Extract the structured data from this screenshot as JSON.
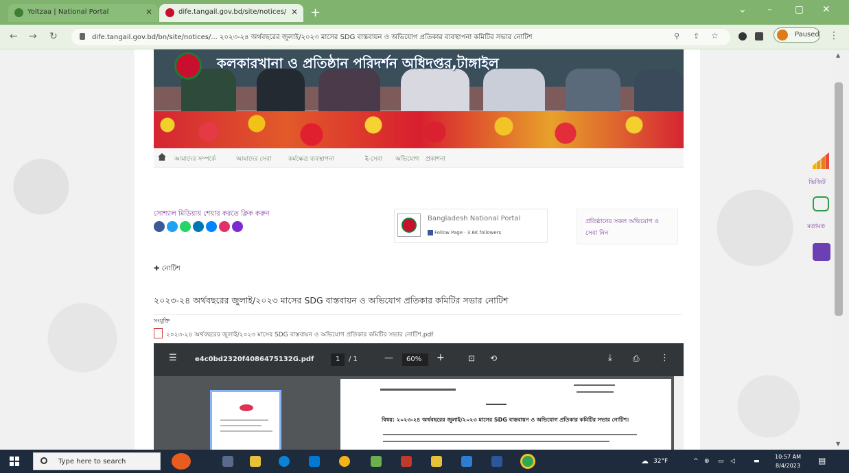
{
  "browser": {
    "tabs": [
      {
        "label": "Yoltzaa | National Portal"
      },
      {
        "label": "dife.tangail.gov.bd/site/notices/"
      }
    ],
    "url": "dife.tangail.gov.bd/bn/site/notices/... ২০২৩-২৪ অর্থবছরের জুলাই/২০২৩ মাসের SDG বাস্তবায়ন ও অভিযোগ প্রতিকার ব্যবস্থাপনা কমিটির সভার নোটিশ",
    "profile_label": "Paused"
  },
  "site": {
    "banner_title": "কলকারখানা ও প্রতিষ্ঠান পরিদর্শন অধিদপ্তর,টাঙ্গাইল",
    "menu": [
      "আমাদের সম্পর্কে",
      "আমাদের সেবা",
      "কর্মক্ষেত্র ব্যবস্থাপনা",
      "ই-সেবা",
      "অভিযোগ",
      "প্রকাশনা"
    ],
    "share_label": "সোশ্যাল মিডিয়ায় শেয়ার করতে ক্লিক করুন",
    "social_colors": [
      "#3b5998",
      "#1da1f2",
      "#25d366",
      "#0077b5",
      "#0084ff",
      "#e1306c",
      "#7b2bd1"
    ],
    "fb_widget": {
      "name": "Bangladesh National Portal",
      "sub": "Follow Page · 3.6K followers"
    },
    "info_box": "প্রতিষ্ঠানের সকল অভিযোগ ও সেবা নিন"
  },
  "notice": {
    "breadcrumb": "নোটিশ",
    "title": "২০২৩-২৪ অর্থবছরের জুলাই/২০২৩ মাসের SDG বাস্তবায়ন ও অভিযোগ প্রতিকার কমিটির সভার নোটিশ",
    "attachment_label": "সংযুক্তি",
    "attachment_link": "২০২৩-২৪ অর্থবছরের জুলাই/২০২৩ মাসের SDG বাস্তবায়ন ও অভিযোগ প্রতিকার কমিটির সভার নোটিশ.pdf"
  },
  "pdf_viewer": {
    "filename": "e4c0bd2320f4086475132G.pdf",
    "page_current": "1",
    "page_total": "/ 1",
    "zoom": "60%",
    "doc_heading": "বিষয়: ২০২৩-২৪ অর্থবছরের জুলাই/২০২৩ মাসের SDG বাস্তবায়ন ও অভিযোগ প্রতিকার কমিটির সভার নোটিশ।"
  },
  "side_widgets": {
    "label1": "ভিজিট",
    "label2": "মতামত"
  },
  "taskbar": {
    "search_placeholder": "Type here to search",
    "weather": "32°F",
    "time": "10:57 AM",
    "date": "8/4/2023"
  }
}
